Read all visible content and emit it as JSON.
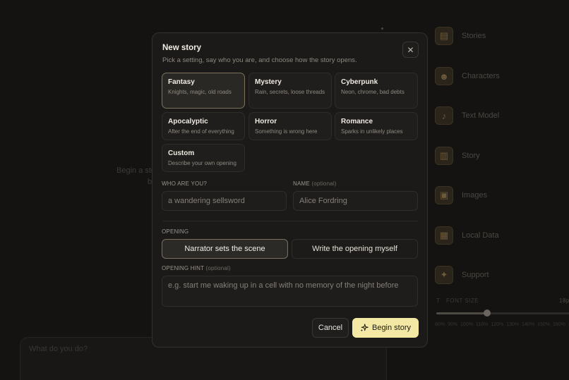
{
  "background": {
    "hint_line1": "Begin a sto",
    "hint_line2": "b",
    "input_placeholder": "What do you do?",
    "sidebar": [
      {
        "label": "Stories",
        "icon": "scroll-icon"
      },
      {
        "label": "Characters",
        "icon": "characters-icon"
      },
      {
        "label": "Text Model",
        "icon": "microphone-icon"
      },
      {
        "label": "Story",
        "icon": "book-icon"
      },
      {
        "label": "Images",
        "icon": "image-icon"
      },
      {
        "label": "Local Data",
        "icon": "database-icon"
      },
      {
        "label": "Support",
        "icon": "support-icon"
      }
    ],
    "font_size_label": "FONT SIZE",
    "font_size_value": "18p",
    "font_size_level": 0.38,
    "font_scale_options": [
      "80%",
      "90%",
      "100%",
      "110%",
      "120%",
      "130%",
      "140%",
      "150%",
      "160%"
    ]
  },
  "modal": {
    "title": "New story",
    "subtitle": "Pick a setting, say who you are, and choose how the story opens.",
    "settings": [
      {
        "name": "Fantasy",
        "desc": "Knights, magic, old roads",
        "selected": true
      },
      {
        "name": "Mystery",
        "desc": "Rain, secrets, loose threads",
        "selected": false
      },
      {
        "name": "Cyberpunk",
        "desc": "Neon, chrome, bad debts",
        "selected": false
      },
      {
        "name": "Apocalyptic",
        "desc": "After the end of everything",
        "selected": false
      },
      {
        "name": "Horror",
        "desc": "Something is wrong here",
        "selected": false
      },
      {
        "name": "Romance",
        "desc": "Sparks in unlikely places",
        "selected": false
      },
      {
        "name": "Custom",
        "desc": "Describe your own opening",
        "selected": false
      }
    ],
    "who_label": "WHO ARE YOU?",
    "who_placeholder": "a wandering sellsword",
    "who_value": "",
    "name_label": "NAME",
    "name_optional": "(optional)",
    "name_placeholder": "Alice Fordring",
    "name_value": "",
    "opening_label": "OPENING",
    "opening_options": [
      "Narrator sets the scene",
      "Write the opening myself"
    ],
    "opening_selected": "Narrator sets the scene",
    "hint_label": "OPENING HINT",
    "hint_optional": "(optional)",
    "hint_placeholder": "e.g. start me waking up in a cell with no memory of the night before",
    "hint_value": "",
    "cancel_label": "Cancel",
    "begin_label": "Begin story"
  },
  "colors": {
    "accent": "#f3e9a5",
    "selected_border": "#7d725f",
    "modal_bg": "#1b1a18",
    "page_bg": "#141312"
  }
}
